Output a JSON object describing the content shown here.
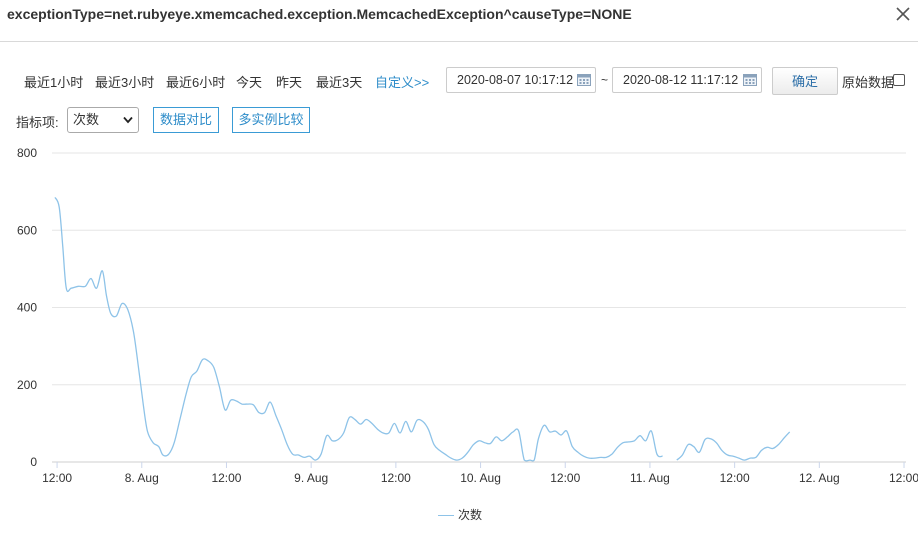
{
  "window": {
    "title": "exceptionType=net.rubyeye.xmemcached.exception.MemcachedException^causeType=NONE"
  },
  "toolbar": {
    "ranges": [
      "最近1小时",
      "最近3小时",
      "最近6小时",
      "今天",
      "昨天",
      "最近3天"
    ],
    "custom_label": "自定义>>",
    "start_date": "2020-08-07 10:17:12",
    "separator": "~",
    "end_date": "2020-08-12 11:17:12",
    "confirm_label": "确定",
    "raw_data_label": "原始数据",
    "raw_data_checked": false
  },
  "metric": {
    "label": "指标项:",
    "selected": "次数",
    "compare_label": "数据对比",
    "multi_instance_label": "多实例比较"
  },
  "colors": {
    "line": "#8ec3e8",
    "link": "#2d8cc9",
    "grid": "#e6e6e6"
  },
  "chart_data": {
    "type": "line",
    "ylim": [
      0,
      800
    ],
    "yticks": [
      0,
      200,
      400,
      600,
      800
    ],
    "xlim": [
      11.28,
      132.28
    ],
    "xticks": [
      {
        "at": 12,
        "label": "12:00"
      },
      {
        "at": 24,
        "label": "8. Aug"
      },
      {
        "at": 36,
        "label": "12:00"
      },
      {
        "at": 48,
        "label": "9. Aug"
      },
      {
        "at": 60,
        "label": "12:00"
      },
      {
        "at": 72,
        "label": "10. Aug"
      },
      {
        "at": 84,
        "label": "12:00"
      },
      {
        "at": 96,
        "label": "11. Aug"
      },
      {
        "at": 108,
        "label": "12:00"
      },
      {
        "at": 120,
        "label": "12. Aug"
      },
      {
        "at": 132,
        "label": "12:00"
      }
    ],
    "legend": [
      "次数"
    ],
    "series": [
      {
        "name": "次数",
        "segments": [
          [
            [
              11.7,
              685
            ],
            [
              12.3,
              660
            ],
            [
              12.8,
              560
            ],
            [
              13.3,
              450
            ],
            [
              14.0,
              450
            ],
            [
              15.0,
              455
            ],
            [
              16.0,
              455
            ],
            [
              16.8,
              475
            ],
            [
              17.6,
              450
            ],
            [
              18.4,
              495
            ],
            [
              19.0,
              430
            ],
            [
              19.6,
              385
            ],
            [
              20.4,
              378
            ],
            [
              21.2,
              410
            ],
            [
              22.0,
              395
            ],
            [
              22.8,
              340
            ],
            [
              23.5,
              250
            ],
            [
              24.2,
              150
            ],
            [
              24.8,
              80
            ],
            [
              25.6,
              50
            ],
            [
              26.4,
              40
            ],
            [
              27.0,
              18
            ],
            [
              27.8,
              20
            ],
            [
              28.6,
              50
            ],
            [
              29.4,
              110
            ],
            [
              30.2,
              170
            ],
            [
              31.0,
              220
            ],
            [
              31.8,
              235
            ],
            [
              32.6,
              265
            ],
            [
              33.4,
              262
            ],
            [
              34.2,
              245
            ],
            [
              35.0,
              195
            ],
            [
              35.8,
              135
            ],
            [
              36.6,
              160
            ],
            [
              37.4,
              158
            ],
            [
              38.2,
              150
            ],
            [
              39.0,
              150
            ],
            [
              39.8,
              148
            ],
            [
              40.6,
              128
            ],
            [
              41.4,
              128
            ],
            [
              42.2,
              155
            ],
            [
              43.0,
              120
            ],
            [
              43.8,
              85
            ],
            [
              44.6,
              45
            ],
            [
              45.4,
              20
            ],
            [
              46.2,
              18
            ],
            [
              47.0,
              12
            ],
            [
              47.8,
              15
            ],
            [
              48.6,
              5
            ],
            [
              49.4,
              20
            ],
            [
              50.2,
              68
            ],
            [
              51.0,
              55
            ],
            [
              51.8,
              58
            ],
            [
              52.6,
              75
            ],
            [
              53.4,
              115
            ],
            [
              54.2,
              110
            ],
            [
              55.0,
              98
            ],
            [
              55.8,
              110
            ],
            [
              56.6,
              100
            ],
            [
              57.4,
              85
            ],
            [
              58.2,
              75
            ],
            [
              59.0,
              75
            ],
            [
              59.8,
              100
            ],
            [
              60.6,
              75
            ],
            [
              61.4,
              105
            ],
            [
              62.2,
              78
            ],
            [
              63.0,
              108
            ],
            [
              63.8,
              105
            ],
            [
              64.6,
              85
            ],
            [
              65.4,
              45
            ],
            [
              66.2,
              30
            ],
            [
              67.0,
              20
            ],
            [
              67.8,
              10
            ],
            [
              68.6,
              5
            ],
            [
              69.4,
              10
            ],
            [
              70.2,
              25
            ],
            [
              71.0,
              45
            ],
            [
              71.8,
              55
            ],
            [
              72.6,
              50
            ],
            [
              73.4,
              48
            ],
            [
              74.2,
              65
            ],
            [
              75.0,
              55
            ],
            [
              75.8,
              65
            ],
            [
              76.6,
              78
            ],
            [
              77.4,
              80
            ],
            [
              78.2,
              5
            ],
            [
              79.0,
              5
            ],
            [
              79.6,
              5
            ],
            [
              80.2,
              60
            ],
            [
              81.0,
              95
            ],
            [
              81.8,
              78
            ],
            [
              82.6,
              80
            ],
            [
              83.4,
              70
            ],
            [
              84.2,
              80
            ],
            [
              85.0,
              40
            ],
            [
              85.8,
              25
            ],
            [
              86.6,
              15
            ],
            [
              87.4,
              10
            ],
            [
              88.2,
              10
            ],
            [
              89.0,
              12
            ],
            [
              89.8,
              12
            ],
            [
              90.6,
              20
            ],
            [
              91.4,
              38
            ],
            [
              92.2,
              50
            ],
            [
              93.0,
              52
            ],
            [
              93.8,
              55
            ],
            [
              94.6,
              68
            ],
            [
              95.4,
              55
            ],
            [
              96.2,
              80
            ],
            [
              97.0,
              20
            ],
            [
              97.8,
              15
            ]
          ],
          [
            [
              99.8,
              5
            ],
            [
              100.6,
              18
            ],
            [
              101.4,
              45
            ],
            [
              102.2,
              40
            ],
            [
              103.0,
              25
            ],
            [
              103.8,
              58
            ],
            [
              104.6,
              60
            ],
            [
              105.4,
              50
            ],
            [
              106.2,
              30
            ],
            [
              107.0,
              18
            ],
            [
              107.8,
              15
            ],
            [
              108.6,
              10
            ],
            [
              109.4,
              5
            ],
            [
              110.2,
              10
            ],
            [
              111.0,
              12
            ],
            [
              111.8,
              30
            ],
            [
              112.6,
              38
            ],
            [
              113.4,
              35
            ],
            [
              114.2,
              45
            ],
            [
              115.0,
              62
            ],
            [
              115.8,
              78
            ]
          ]
        ]
      }
    ]
  }
}
